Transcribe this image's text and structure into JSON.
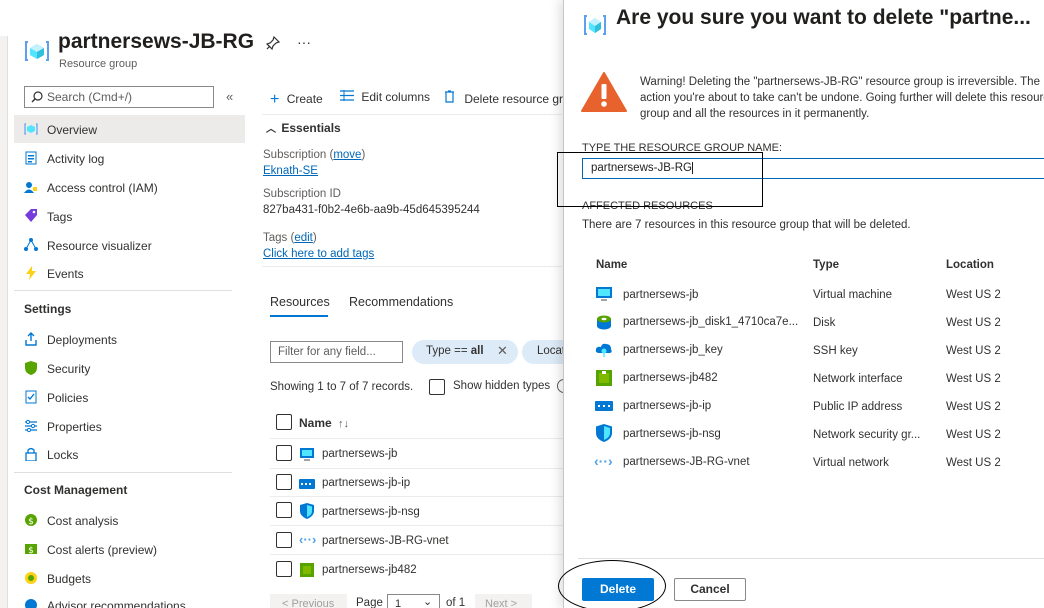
{
  "left_blade": {
    "title": "partnersews-JB-RG",
    "subtitle": "Resource group",
    "more": "···",
    "search_placeholder": "Search (Cmd+/)",
    "collapse": "«",
    "nav": [
      {
        "label": "Overview",
        "icon": "resource-group-icon"
      },
      {
        "label": "Activity log",
        "icon": "activity-log-icon"
      },
      {
        "label": "Access control (IAM)",
        "icon": "iam-icon"
      },
      {
        "label": "Tags",
        "icon": "tag-icon"
      },
      {
        "label": "Resource visualizer",
        "icon": "visualizer-icon"
      },
      {
        "label": "Events",
        "icon": "events-icon"
      }
    ],
    "settings_header": "Settings",
    "settings": [
      {
        "label": "Deployments",
        "icon": "deployments-icon"
      },
      {
        "label": "Security",
        "icon": "security-icon"
      },
      {
        "label": "Policies",
        "icon": "policies-icon"
      },
      {
        "label": "Properties",
        "icon": "properties-icon"
      },
      {
        "label": "Locks",
        "icon": "lock-icon"
      }
    ],
    "cost_header": "Cost Management",
    "cost": [
      {
        "label": "Cost analysis",
        "icon": "cost-analysis-icon"
      },
      {
        "label": "Cost alerts (preview)",
        "icon": "cost-alerts-icon"
      },
      {
        "label": "Budgets",
        "icon": "budgets-icon"
      },
      {
        "label": "Advisor recommendations",
        "icon": "advisor-icon"
      }
    ]
  },
  "commands": {
    "create": "Create",
    "edit_columns": "Edit columns",
    "delete": "Delete resource gro"
  },
  "essentials": {
    "header": "Essentials",
    "subscription_label": "Subscription",
    "move": "move",
    "subscription_value": "Eknath-SE",
    "subscription_id_label": "Subscription ID",
    "subscription_id": "827ba431-f0b2-4e6b-aa9b-45d645395244",
    "tags_label": "Tags",
    "edit": "edit",
    "add_tags": "Click here to add tags"
  },
  "resources_pane": {
    "tabs": [
      "Resources",
      "Recommendations"
    ],
    "filter_placeholder": "Filter for any field...",
    "type_pill_prefix": "Type == ",
    "type_pill_value": "all",
    "location_pill": "Locat",
    "showing": "Showing 1 to 7 of 7 records.",
    "show_hidden": "Show hidden types",
    "name_header": "Name",
    "sort": "↑↓",
    "rows": [
      "partnersews-jb",
      "partnersews-jb-ip",
      "partnersews-jb-nsg",
      "partnersews-JB-RG-vnet",
      "partnersews-jb482"
    ],
    "prev": "< Previous",
    "page_label": "Page",
    "page_value": "1",
    "of": "of 1",
    "next": "Next >"
  },
  "dialog": {
    "title": "Are you sure you want to delete \"partne...",
    "warning": "Warning! Deleting the \"partnersews-JB-RG\" resource group is irreversible. The action you're about to take can't be undone. Going further will delete this resource group and all the resources in it permanently.",
    "type_label": "TYPE THE RESOURCE GROUP NAME:",
    "input_value": "partnersews-JB-RG",
    "affected_label": "AFFECTED RESOURCES",
    "affected_desc": "There are 7 resources in this resource group that will be deleted.",
    "headers": [
      "Name",
      "Type",
      "Location"
    ],
    "resources": [
      {
        "name": "partnersews-jb",
        "type": "Virtual machine",
        "location": "West US 2",
        "icon": "vm-icon"
      },
      {
        "name": "partnersews-jb_disk1_4710ca7e...",
        "type": "Disk",
        "location": "West US 2",
        "icon": "disk-icon"
      },
      {
        "name": "partnersews-jb_key",
        "type": "SSH key",
        "location": "West US 2",
        "icon": "ssh-key-icon"
      },
      {
        "name": "partnersews-jb482",
        "type": "Network interface",
        "location": "West US 2",
        "icon": "nic-icon"
      },
      {
        "name": "partnersews-jb-ip",
        "type": "Public IP address",
        "location": "West US 2",
        "icon": "public-ip-icon"
      },
      {
        "name": "partnersews-jb-nsg",
        "type": "Network security gr...",
        "location": "West US 2",
        "icon": "nsg-icon"
      },
      {
        "name": "partnersews-JB-RG-vnet",
        "type": "Virtual network",
        "location": "West US 2",
        "icon": "vnet-icon"
      }
    ],
    "delete_label": "Delete",
    "cancel_label": "Cancel"
  },
  "colors": {
    "accent": "#0078d4",
    "link": "#0067b8",
    "warning": "#e8622d"
  }
}
